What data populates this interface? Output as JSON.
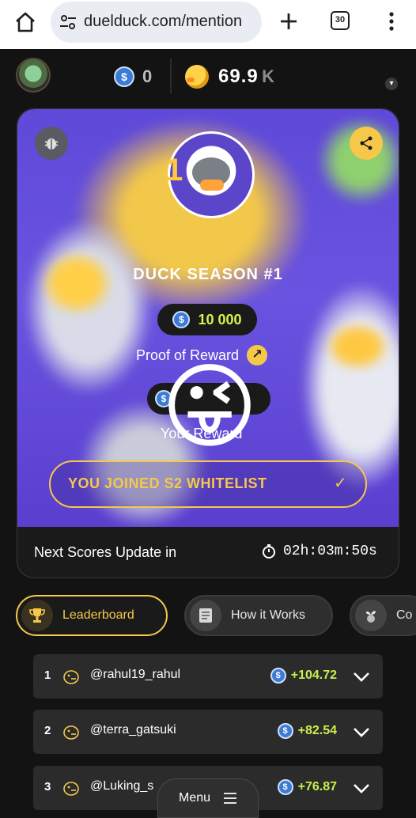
{
  "browser": {
    "url": "duelduck.com/mention",
    "tab_count": "30"
  },
  "header": {
    "usdc_balance": "0",
    "duck_balance": "69.9",
    "duck_unit": "K"
  },
  "season": {
    "title": "DUCK SEASON #1",
    "reward_amount": "10 000",
    "proof_label": "Proof of Reward",
    "your_reward_label": "Your Reward",
    "whitelist_button": "YOU JOINED S2 WHITELIST",
    "next_update_label": "Next Scores Update in",
    "countdown": "02h:03m:50s"
  },
  "tabs": [
    {
      "label": "Leaderboard",
      "icon": "trophy-icon",
      "active": true
    },
    {
      "label": "How it Works",
      "icon": "document-icon",
      "active": false
    },
    {
      "label": "Co",
      "icon": "sprout-icon",
      "active": false
    }
  ],
  "leaderboard": [
    {
      "rank": "1",
      "user": "@rahul19_rahul",
      "score": "+104.72"
    },
    {
      "rank": "2",
      "user": "@terra_gatsuki",
      "score": "+82.54"
    },
    {
      "rank": "3",
      "user": "@Luking_s",
      "score": "+76.87"
    }
  ],
  "menu_label": "Menu",
  "colors": {
    "accent": "#f5c84a",
    "score_green": "#c8f04a",
    "background": "#131313",
    "card_purple": "#6a53e0"
  }
}
